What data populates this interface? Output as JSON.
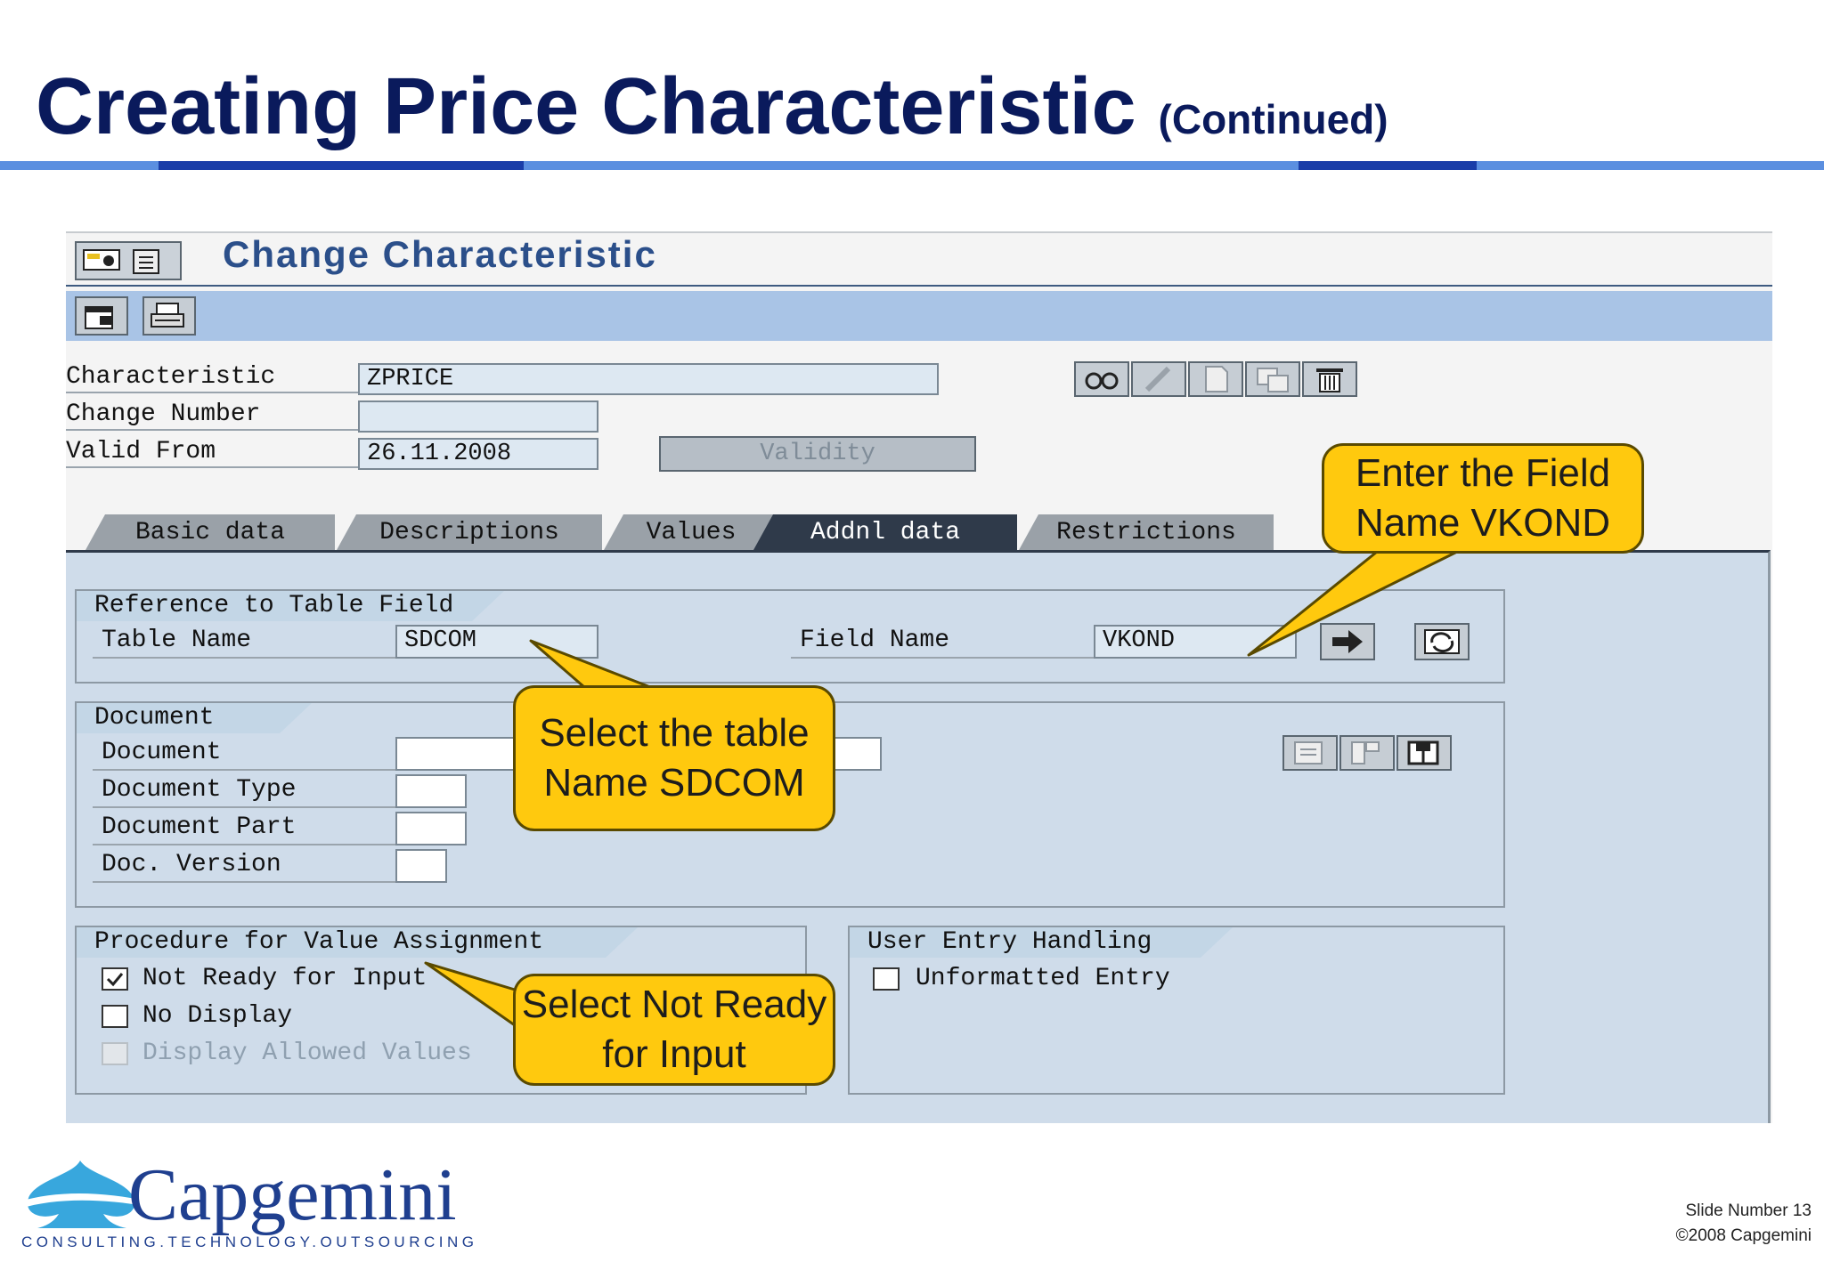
{
  "slide": {
    "title": "Creating Price Characteristic",
    "subtitle": "(Continued)"
  },
  "sap": {
    "window_title": "Change Characteristic",
    "fields": {
      "characteristic_label": "Characteristic",
      "characteristic_value": "ZPRICE",
      "change_number_label": "Change Number",
      "change_number_value": "",
      "valid_from_label": "Valid From",
      "valid_from_value": "26.11.2008",
      "validity_button": "Validity"
    },
    "tabs": [
      {
        "label": "Basic data",
        "active": false
      },
      {
        "label": "Descriptions",
        "active": false
      },
      {
        "label": "Values",
        "active": false
      },
      {
        "label": "Addnl data",
        "active": true
      },
      {
        "label": "Restrictions",
        "active": false
      }
    ],
    "ref_table": {
      "title": "Reference to Table Field",
      "table_name_label": "Table Name",
      "table_name_value": "SDCOM",
      "field_name_label": "Field Name",
      "field_name_value": "VKOND"
    },
    "document": {
      "title": "Document",
      "document_label": "Document",
      "document_value": "",
      "type_label": "Document Type",
      "part_label": "Document Part",
      "version_label": "Doc. Version"
    },
    "procedure": {
      "title": "Procedure for Value Assignment",
      "not_ready_label": "Not Ready for Input",
      "not_ready_checked": true,
      "no_display_label": "No Display",
      "no_display_checked": false,
      "display_allowed_label": "Display Allowed Values",
      "display_allowed_checked": false
    },
    "user_entry": {
      "title": "User Entry Handling",
      "unformatted_label": "Unformatted Entry",
      "unformatted_checked": false
    },
    "icons": [
      "settings-icon",
      "menu-icon",
      "new-window-icon",
      "print-icon",
      "display-icon",
      "edit-icon",
      "create-icon",
      "copy-icon",
      "delete-icon",
      "go-arrow-icon",
      "refresh-icon",
      "doc-list-icon",
      "doc-tree-icon",
      "doc-details-icon"
    ]
  },
  "callouts": {
    "field_name": "Enter the Field Name VKOND",
    "table_name": "Select the table Name SDCOM",
    "not_ready": "Select Not Ready for Input"
  },
  "brand": {
    "logo_name": "Capgemini",
    "tagline": "CONSULTING.TECHNOLOGY.OUTSOURCING"
  },
  "footer": {
    "slide_number": "Slide Number 13",
    "copyright": "©2008 Capgemini"
  },
  "colors": {
    "title": "#0a1a5c",
    "accent_bar_light": "#5b8fe0",
    "accent_bar_dark": "#1a3da8",
    "sap_header": "#a9c4e6",
    "sap_panel": "#cfdcea",
    "callout": "#ffc90e"
  }
}
